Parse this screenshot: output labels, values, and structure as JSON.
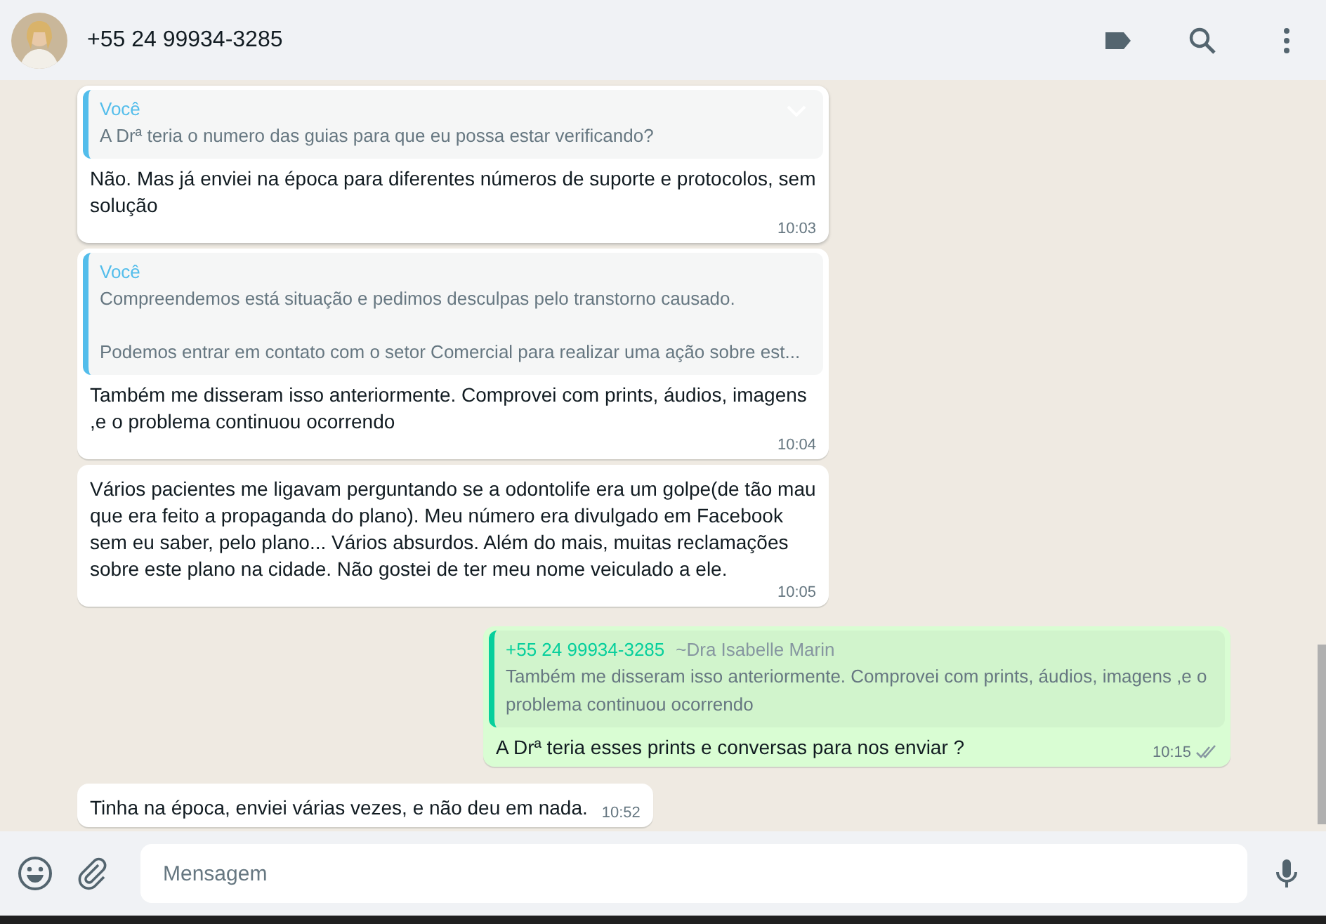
{
  "header": {
    "contact": "+55 24 99934-3285"
  },
  "messages": [
    {
      "kind": "incoming",
      "hovered": true,
      "quote": {
        "author": "Você",
        "color": "#53bdeb",
        "lines": [
          "A Drª teria o numero das guias para que eu possa estar verificando?"
        ]
      },
      "text": "Não. Mas já enviei na época para diferentes números de suporte e protocolos, sem solução",
      "time": "10:03"
    },
    {
      "kind": "incoming",
      "hovered": false,
      "quote": {
        "author": "Você",
        "color": "#53bdeb",
        "lines": [
          "Compreendemos está situação e pedimos desculpas pelo transtorno causado.",
          "Podemos entrar em contato com o setor Comercial para realizar uma ação sobre est..."
        ]
      },
      "text": "Também me disseram isso anteriormente. Comprovei com prints, áudios, imagens ,e o problema continuou ocorrendo",
      "time": "10:04"
    },
    {
      "kind": "incoming",
      "hovered": false,
      "text": "Vários pacientes me ligavam perguntando se a odontolife era um golpe(de tão mau que era feito a propaganda do plano). Meu número era divulgado em Facebook sem eu saber, pelo plano... Vários absurdos. Além do mais, muitas reclamações sobre este plano na cidade. Não gostei de ter meu nome veiculado a ele.",
      "time": "10:05"
    },
    {
      "kind": "outgoing",
      "hovered": false,
      "quote": {
        "author": "+55 24 99934-3285",
        "color": "#06cf9c",
        "push_name": "~Dra Isabelle Marin",
        "lines": [
          "Também me disseram isso anteriormente. Comprovei com prints, áudios, imagens ,e o problema continuou ocorrendo"
        ]
      },
      "text": "A Drª teria esses prints e conversas para nos enviar ?",
      "time": "10:15",
      "read": false
    },
    {
      "kind": "incoming",
      "hovered": false,
      "text": "Tinha na época, enviei várias vezes, e não deu em nada.",
      "time": "10:52"
    }
  ],
  "composer": {
    "placeholder": "Mensagem"
  }
}
